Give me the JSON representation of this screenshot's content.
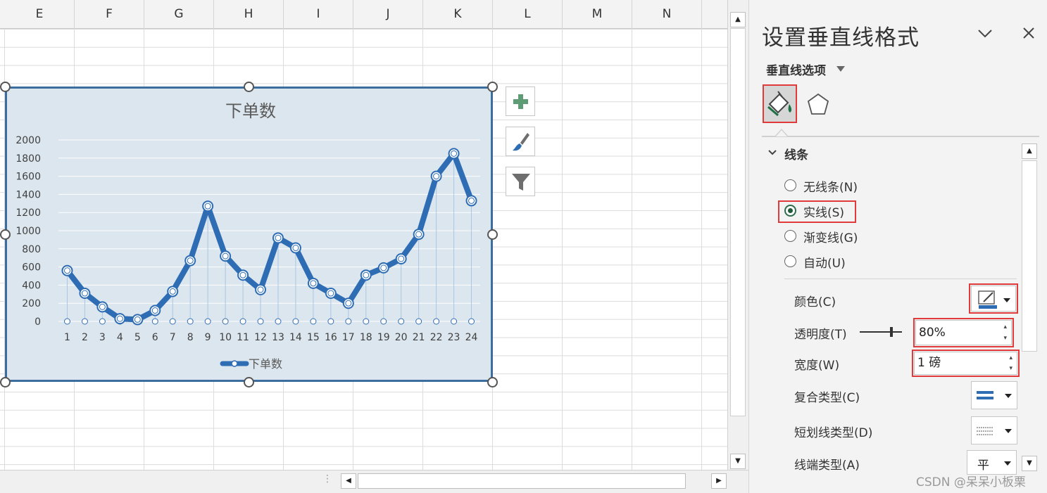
{
  "sheet": {
    "columns": [
      "E",
      "F",
      "G",
      "H",
      "I",
      "J",
      "K",
      "L",
      "M",
      "N"
    ]
  },
  "chart_data": {
    "type": "line",
    "title": "下单数",
    "categories": [
      "1",
      "2",
      "3",
      "4",
      "5",
      "6",
      "7",
      "8",
      "9",
      "10",
      "11",
      "12",
      "13",
      "14",
      "15",
      "16",
      "17",
      "18",
      "19",
      "20",
      "21",
      "22",
      "23",
      "24"
    ],
    "series": [
      {
        "name": "下单数",
        "values": [
          560,
          310,
          160,
          30,
          20,
          120,
          330,
          670,
          1270,
          720,
          510,
          350,
          920,
          810,
          420,
          310,
          200,
          510,
          590,
          690,
          960,
          1600,
          1850,
          1330
        ]
      }
    ],
    "yticks": [
      "0",
      "200",
      "400",
      "600",
      "800",
      "1000",
      "1200",
      "1400",
      "1600",
      "1800",
      "2000"
    ],
    "ylim": [
      0,
      2000
    ],
    "drop_lines": true,
    "grid": true,
    "legend_position": "bottom",
    "colors": {
      "series": "#2e6db4",
      "plot_bg": "#dce6ee",
      "drop_line": "#a9c6e4"
    }
  },
  "chart_tools": {
    "add_icon": "plus-icon",
    "style_icon": "brush-icon",
    "filter_icon": "filter-icon"
  },
  "pane": {
    "title": "设置垂直线格式",
    "options_label": "垂直线选项",
    "section_label": "线条",
    "radios": [
      {
        "label": "无线条(N)",
        "checked": false
      },
      {
        "label": "实线(S)",
        "checked": true
      },
      {
        "label": "渐变线(G)",
        "checked": false
      },
      {
        "label": "自动(U)",
        "checked": false
      }
    ],
    "color_label": "颜色(C)",
    "transparency_label": "透明度(T)",
    "transparency_value": "80%",
    "width_label": "宽度(W)",
    "width_value": "1 磅",
    "compound_label": "复合类型(C)",
    "dash_label": "短划线类型(D)",
    "cap_label": "线端类型(A)",
    "cap_value": "平",
    "accent": "#e03a3a"
  },
  "watermark": "CSDN @呆呆小板栗"
}
